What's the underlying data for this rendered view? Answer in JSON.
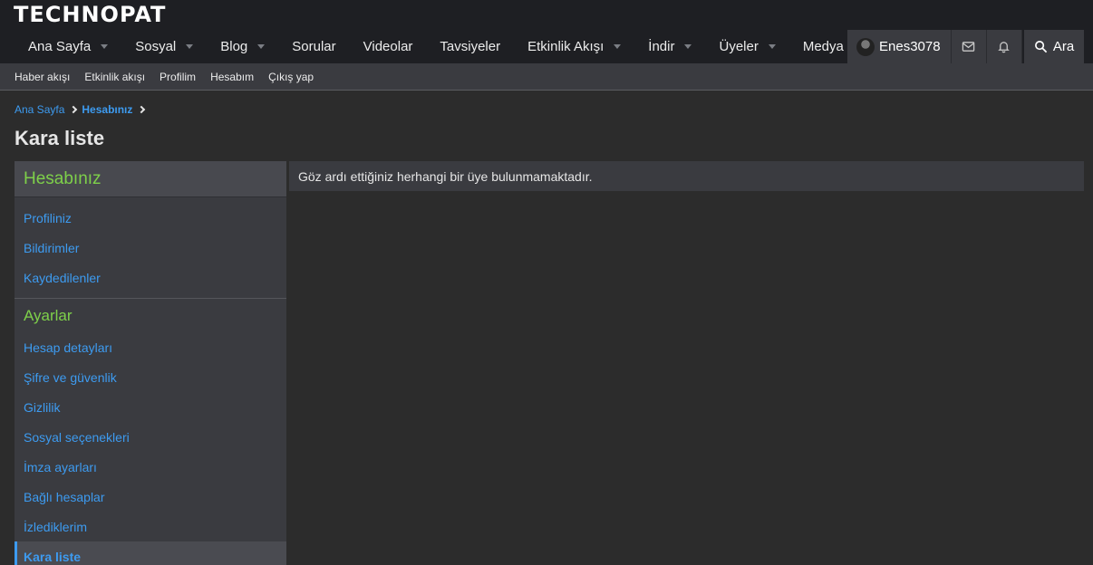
{
  "brand": {
    "logo_text": "TECHNOPAT"
  },
  "nav": {
    "tabs": [
      {
        "label": "Ana Sayfa",
        "has_dropdown": true
      },
      {
        "label": "Sosyal",
        "has_dropdown": true
      },
      {
        "label": "Blog",
        "has_dropdown": true
      },
      {
        "label": "Sorular",
        "has_dropdown": false
      },
      {
        "label": "Videolar",
        "has_dropdown": false
      },
      {
        "label": "Tavsiyeler",
        "has_dropdown": false
      },
      {
        "label": "Etkinlik Akışı",
        "has_dropdown": true
      },
      {
        "label": "İndir",
        "has_dropdown": true
      },
      {
        "label": "Üyeler",
        "has_dropdown": true
      },
      {
        "label": "Medya",
        "has_dropdown": true
      }
    ],
    "user": {
      "name": "Enes3078"
    },
    "search_label": "Ara"
  },
  "subnav": {
    "links": [
      "Haber akışı",
      "Etkinlik akışı",
      "Profilim",
      "Hesabım",
      "Çıkış yap"
    ]
  },
  "breadcrumb": {
    "items": [
      "Ana Sayfa",
      "Hesabınız"
    ]
  },
  "page": {
    "title": "Kara liste",
    "empty_message": "Göz ardı ettiğiniz herhangi bir üye bulunmamaktadır."
  },
  "sidebar": {
    "header": "Hesabınız",
    "account_items": [
      "Profiliniz",
      "Bildirimler",
      "Kaydedilenler"
    ],
    "settings_title": "Ayarlar",
    "settings_items": [
      "Hesap detayları",
      "Şifre ve güvenlik",
      "Gizlilik",
      "Sosyal seçenekleri",
      "İmza ayarları",
      "Bağlı hesaplar",
      "İzlediklerim",
      "Kara liste"
    ],
    "active_item": "Kara liste"
  },
  "colors": {
    "accent_link": "#3d9bf0",
    "section_green": "#7ed04a",
    "header_bg": "#1e1f23",
    "page_bg": "#2c2c2c"
  },
  "icons": [
    "mail-icon",
    "bell-icon",
    "search-icon",
    "chevron-right-icon",
    "caret-down-icon"
  ]
}
